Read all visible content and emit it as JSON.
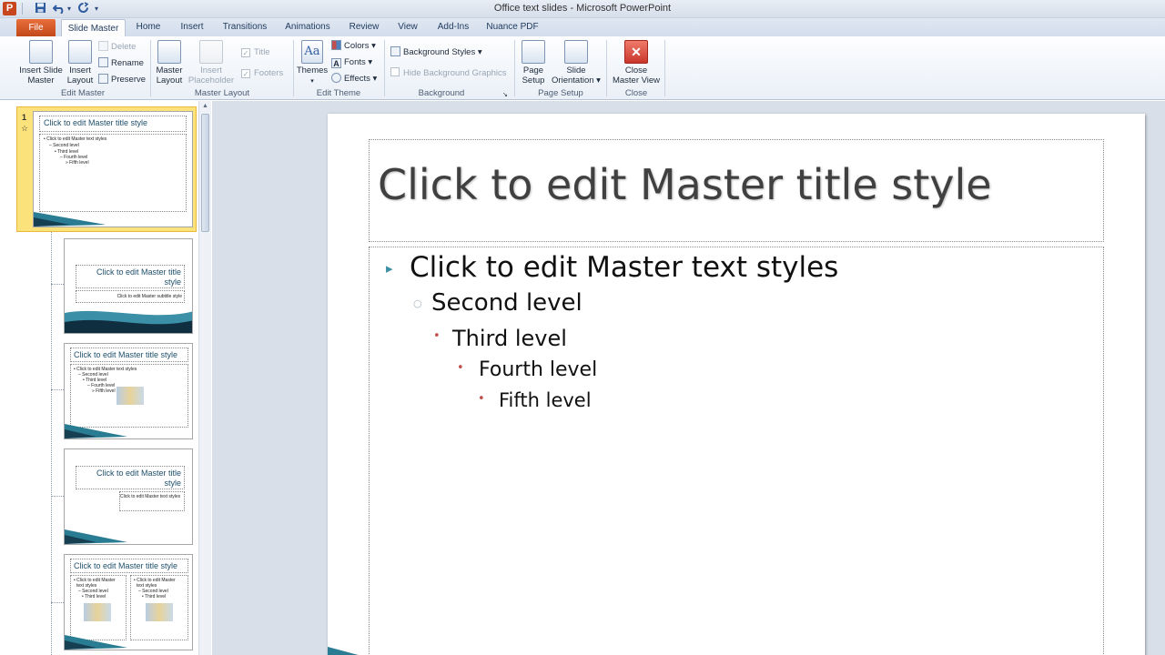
{
  "window": {
    "title": "Office text slides - Microsoft PowerPoint",
    "app_logo": "P"
  },
  "quick_access": {
    "save_icon": "save-icon",
    "undo_icon": "undo-icon",
    "redo_icon": "redo-icon"
  },
  "tabs": [
    {
      "label": "File"
    },
    {
      "label": "Slide Master"
    },
    {
      "label": "Home"
    },
    {
      "label": "Insert"
    },
    {
      "label": "Transitions"
    },
    {
      "label": "Animations"
    },
    {
      "label": "Review"
    },
    {
      "label": "View"
    },
    {
      "label": "Add-Ins"
    },
    {
      "label": "Nuance PDF"
    }
  ],
  "ribbon": {
    "edit_master": {
      "label": "Edit Master",
      "insert_slide_master": [
        "Insert Slide",
        "Master"
      ],
      "insert_layout": [
        "Insert",
        "Layout"
      ],
      "delete": "Delete",
      "rename": "Rename",
      "preserve": "Preserve"
    },
    "master_layout": {
      "label": "Master Layout",
      "master_layout_btn": [
        "Master",
        "Layout"
      ],
      "insert_placeholder": [
        "Insert",
        "Placeholder"
      ],
      "title_chk": "Title",
      "footers_chk": "Footers"
    },
    "edit_theme": {
      "label": "Edit Theme",
      "themes": "Themes",
      "colors": "Colors",
      "fonts": "Fonts",
      "effects": "Effects"
    },
    "background": {
      "label": "Background",
      "background_styles": "Background Styles",
      "hide_bg_graphics": "Hide Background Graphics"
    },
    "page_setup": {
      "label": "Page Setup",
      "page_setup_btn": [
        "Page",
        "Setup"
      ],
      "slide_orientation": [
        "Slide",
        "Orientation"
      ]
    },
    "close": {
      "label": "Close",
      "close_master_view": [
        "Close",
        "Master View"
      ]
    }
  },
  "thumbnails": {
    "selected_number": "1",
    "star": "☆",
    "master_title": "Click to edit Master title style",
    "master_levels": [
      "• Click to edit Master text styles",
      "– Second level",
      "• Third level",
      "– Fourth level",
      "» Fifth level"
    ],
    "layout2_title": "Click to edit Master title style",
    "layout2_sub": "Click to edit Master subtitle style",
    "layout3_title": "Click to edit Master title style",
    "layout3_levels": [
      "• Click to edit Master text styles",
      "– Second level",
      "• Third level",
      "– Fourth level",
      "» Fifth level"
    ],
    "layout4_title": "Click to edit Master title style",
    "layout4_sub": "Click to edit Master text styles",
    "layout5_title": "Click to edit Master title style",
    "layout5_left": [
      "• Click to edit Master",
      "text styles",
      "– Second level",
      "• Third level"
    ],
    "layout5_right": [
      "• Click to edit Master",
      "text styles",
      "– Second level",
      "• Third level"
    ]
  },
  "slide": {
    "title": "Click to edit Master title style",
    "levels": [
      {
        "text": "Click to edit Master text styles",
        "bullet": "▸"
      },
      {
        "text": "Second level",
        "bullet": "○"
      },
      {
        "text": "Third level",
        "bullet": "•"
      },
      {
        "text": "Fourth level",
        "bullet": "•"
      },
      {
        "text": "Fifth level",
        "bullet": "•"
      }
    ]
  },
  "colors": {
    "accent_teal": "#2a7c93",
    "bullet_red": "#c0504d",
    "bullet_teal": "#3d8fa4",
    "file_tab": "#d35a25",
    "selection": "#fbe27a"
  }
}
